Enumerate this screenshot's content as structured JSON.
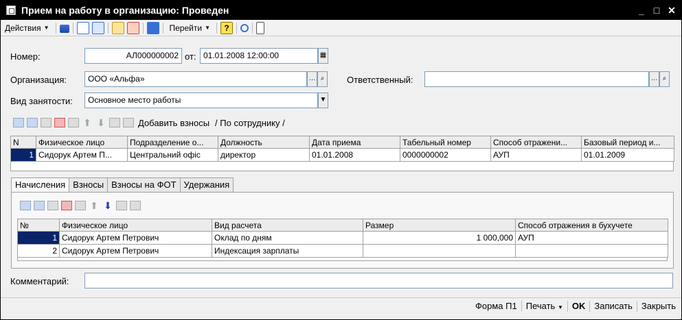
{
  "window": {
    "title": "Прием на работу в организацию: Проведен"
  },
  "toolbar": {
    "actions_label": "Действия",
    "goto_label": "Перейти",
    "help_glyph": "?"
  },
  "form": {
    "number_label": "Номер:",
    "number_value": "АЛ000000002",
    "from_label": "от:",
    "date_value": "01.01.2008 12:00:00",
    "org_label": "Организация:",
    "org_value": "ООО «Альфа»",
    "responsible_label": "Ответственный:",
    "responsible_value": "",
    "employment_label": "Вид занятости:",
    "employment_value": "Основное место работы",
    "comment_label": "Комментарий:",
    "comment_value": ""
  },
  "employees_toolbar": {
    "add_contrib": "Добавить взносы",
    "by_employee": "/ По сотруднику /"
  },
  "employees_table": {
    "columns": [
      "N",
      "Физическое лицо",
      "Подразделение о...",
      "Должность",
      "Дата приема",
      "Табельный номер",
      "Способ отражени...",
      "Базовый период и..."
    ],
    "rows": [
      [
        "1",
        "Сидорук Артем П...",
        "Центральний офіс",
        "директор",
        "01.01.2008",
        "0000000002",
        "АУП",
        "01.01.2009"
      ]
    ]
  },
  "tabs": [
    "Начисления",
    "Взносы",
    "Взносы на ФОТ",
    "Удержания"
  ],
  "accruals_table": {
    "columns": [
      "№",
      "Физическое лицо",
      "Вид расчета",
      "Размер",
      "Способ отражения в бухучете"
    ],
    "rows": [
      [
        "1",
        "Сидорук Артем Петрович",
        "Оклад по дням",
        "1 000,000",
        "АУП"
      ],
      [
        "2",
        "Сидорук Артем Петрович",
        "Индексация зарплаты",
        "",
        ""
      ]
    ]
  },
  "bottombar": {
    "form_p1": "Форма П1",
    "print": "Печать",
    "ok": "OK",
    "save": "Записать",
    "close": "Закрыть"
  }
}
